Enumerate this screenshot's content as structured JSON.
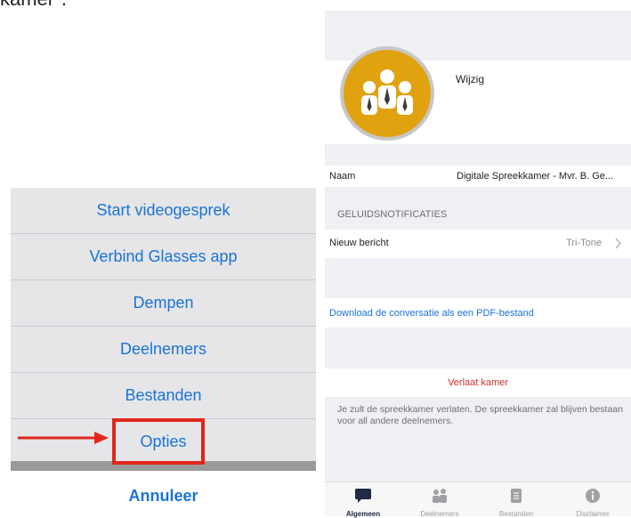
{
  "top_fragment": "kamer\".",
  "action_sheet": {
    "items": [
      {
        "label": "Start videogesprek"
      },
      {
        "label": "Verbind Glasses app"
      },
      {
        "label": "Dempen"
      },
      {
        "label": "Deelnemers"
      },
      {
        "label": "Bestanden"
      },
      {
        "label": "Opties"
      }
    ],
    "cancel_label": "Annuleer"
  },
  "settings": {
    "edit_label": "Wijzig",
    "name_label": "Naam",
    "name_value": "Digitale Spreekkamer - Mvr. B. Ge...",
    "sound_section": "GELUIDSNOTIFICATIES",
    "new_message_label": "Nieuw bericht",
    "new_message_value": "Tri-Tone",
    "download_link": "Download de conversatie als een PDF-bestand",
    "leave_label": "Verlaat kamer",
    "leave_info": "Je zult de spreekkamer verlaten. De spreekkamer zal blijven bestaan voor all andere deelnemers."
  },
  "tabbar": {
    "tabs": [
      {
        "label": "Algemeen",
        "icon": "chat-icon"
      },
      {
        "label": "Deelnemers",
        "icon": "people-icon"
      },
      {
        "label": "Bestanden",
        "icon": "document-icon"
      },
      {
        "label": "Disclaimer",
        "icon": "info-icon"
      }
    ]
  },
  "colors": {
    "accent_blue": "#1a73d6",
    "highlight_red": "#e0271b",
    "avatar_gold": "#e0a20f",
    "destructive_red": "#d0312d"
  }
}
